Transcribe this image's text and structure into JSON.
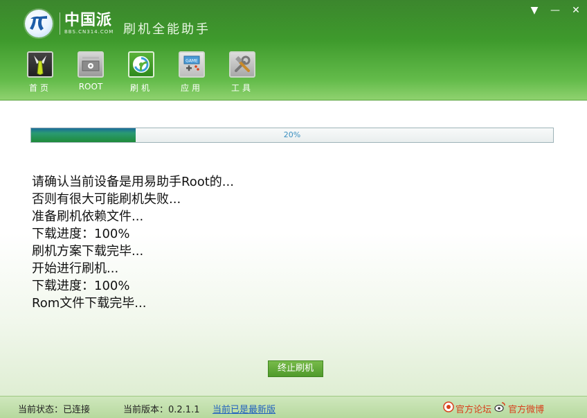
{
  "header": {
    "logo_cn": "中国派",
    "logo_url": "BBS.CN314.COM",
    "app_title": "刷机全能助手"
  },
  "window_controls": {
    "menu": "▼",
    "minimize": "—",
    "close": "✕"
  },
  "nav": [
    {
      "label": "首页",
      "icon": "tie-icon"
    },
    {
      "label": "ROOT",
      "icon": "root-gear-icon"
    },
    {
      "label": "刷机",
      "icon": "flash-refresh-icon"
    },
    {
      "label": "应用",
      "icon": "game-icon"
    },
    {
      "label": "工具",
      "icon": "tools-icon"
    }
  ],
  "progress": {
    "value_percent": 20,
    "text": "20%"
  },
  "log_lines": [
    "请确认当前设备是用易助手Root的...",
    "否则有很大可能刷机失败...",
    "准备刷机依赖文件...",
    "下载进度：100%",
    "刷机方案下载完毕...",
    "开始进行刷机...",
    "下载进度：100%",
    "Rom文件下载完毕..."
  ],
  "stop_button": "终止刷机",
  "status": {
    "state": "当前状态：已连接",
    "version": "当前版本：0.2.1.1",
    "update": "当前已是最新版",
    "forum": "官方论坛",
    "weibo": "官方微博"
  },
  "colors": {
    "accent_green": "#3e9a2c",
    "progress_fill": "#1f8b3a",
    "link_red": "#d8401c"
  }
}
